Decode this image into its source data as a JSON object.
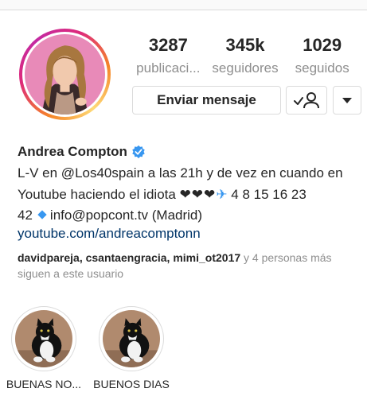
{
  "profile": {
    "name": "Andrea Compton",
    "verified": true
  },
  "stats": [
    {
      "value": "3287",
      "label": "publicaci..."
    },
    {
      "value": "345k",
      "label": "seguidores"
    },
    {
      "value": "1029",
      "label": "seguidos"
    }
  ],
  "actions": {
    "message_label": "Enviar mensaje",
    "follow_icon": "following-check-person-icon",
    "more_icon": "caret-down-icon"
  },
  "bio": {
    "line1": "L-V en @Los40spain a las 21h y de vez en cuando en",
    "line2_text": "Youtube haciendo el idiota",
    "line2_hearts": "❤❤❤",
    "line2_plane": "✈",
    "line2_numbers": "4 8 15 16 23",
    "line3_number": "42",
    "line3_contact": "info@popcont.tv (Madrid)",
    "link": "youtube.com/andreacomptonn"
  },
  "followed_by": {
    "users": "davidpareja, csantaengracia, mimi_ot2017",
    "suffix": " y 4 personas más siguen a este usuario"
  },
  "highlights": [
    {
      "label": "BUENAS NO..."
    },
    {
      "label": "BUENOS DIAS"
    }
  ],
  "colors": {
    "verified_blue": "#3897f0",
    "link_blue": "#003569",
    "muted": "#8e8e8e",
    "border": "#dbdbdb"
  }
}
